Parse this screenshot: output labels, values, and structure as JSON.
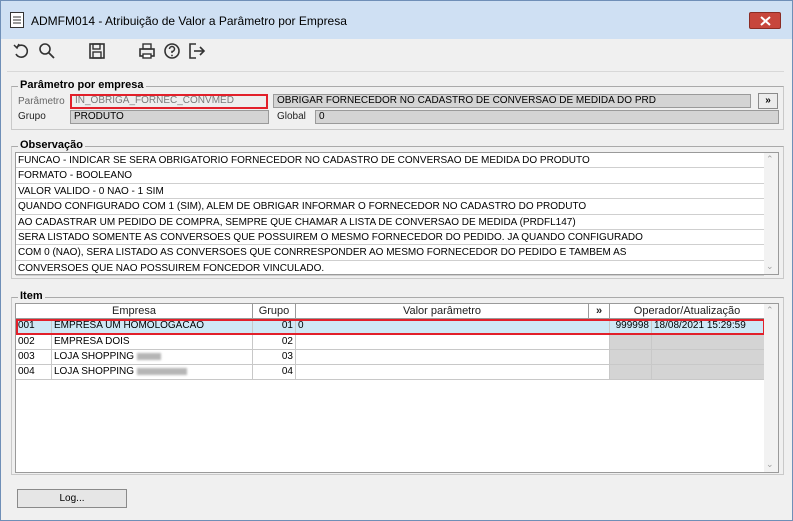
{
  "window": {
    "title": "ADMFM014 - Atribuição de Valor a Parâmetro por Empresa"
  },
  "toolbar": {
    "icons": [
      "refresh-icon",
      "search-icon",
      "save-icon",
      "print-icon",
      "help-icon",
      "exit-icon"
    ]
  },
  "param_group": {
    "title": "Parâmetro por empresa",
    "param_label": "Parâmetro",
    "param_value": "IN_OBRIGA_FORNEC_CONVMED",
    "param_desc": "OBRIGAR FORNECEDOR NO CADASTRO DE CONVERSAO DE MEDIDA DO PRD",
    "more_label": "»",
    "grupo_label": "Grupo",
    "grupo_value": "PRODUTO",
    "global_label": "Global",
    "global_value": "0"
  },
  "observacao": {
    "title": "Observação",
    "lines": [
      "FUNCAO - INDICAR SE SERA OBRIGATORIO FORNECEDOR NO CADASTRO DE CONVERSAO DE MEDIDA DO PRODUTO",
      "FORMATO - BOOLEANO",
      "VALOR VALIDO - 0  NAO - 1 SIM",
      "QUANDO CONFIGURADO COM 1 (SIM), ALEM DE OBRIGAR INFORMAR O FORNECEDOR NO CADASTRO DO PRODUTO",
      "AO CADASTRAR UM PEDIDO DE COMPRA, SEMPRE QUE CHAMAR A LISTA DE CONVERSAO DE MEDIDA (PRDFL147)",
      "SERA LISTADO SOMENTE AS CONVERSOES QUE POSSUIREM O MESMO FORNECEDOR DO PEDIDO. JA QUANDO CONFIGURADO",
      "COM 0 (NAO), SERA LISTADO AS CONVERSOES QUE CONRRESPONDER AO MESMO FORNECEDOR DO PEDIDO E TAMBEM AS",
      "CONVERSOES QUE NAO POSSUIREM FONCEDOR VINCULADO."
    ]
  },
  "item": {
    "title": "Item",
    "columns": {
      "empresa": "Empresa",
      "grupo": "Grupo",
      "valor": "Valor parâmetro",
      "more": "»",
      "operador": "Operador/Atualização"
    },
    "rows": [
      {
        "code": "001",
        "empresa": "EMPRESA UM HOMOLOGACAO",
        "grupo": "01",
        "valor": "0",
        "operador": "999998",
        "data": "18/08/2021 15:29:59"
      },
      {
        "code": "002",
        "empresa": "EMPRESA DOIS",
        "grupo": "02",
        "valor": "",
        "operador": "",
        "data": ""
      },
      {
        "code": "003",
        "empresa": "LOJA SHOPPING",
        "grupo": "03",
        "valor": "",
        "operador": "",
        "data": ""
      },
      {
        "code": "004",
        "empresa": "LOJA SHOPPING",
        "grupo": "04",
        "valor": "",
        "operador": "",
        "data": ""
      }
    ]
  },
  "footer": {
    "log_label": "Log..."
  }
}
